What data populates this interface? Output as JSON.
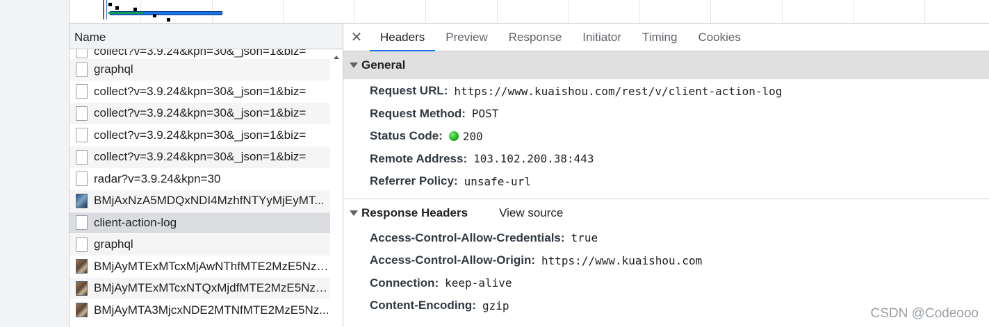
{
  "request_list": {
    "column_header": "Name",
    "rows": [
      {
        "name": "collect?v=3.9.24&kpn=30&_json=1&biz=",
        "icon": "document-icon",
        "partial": true
      },
      {
        "name": "graphql",
        "icon": "document-icon"
      },
      {
        "name": "collect?v=3.9.24&kpn=30&_json=1&biz=",
        "icon": "document-icon"
      },
      {
        "name": "collect?v=3.9.24&kpn=30&_json=1&biz=",
        "icon": "document-icon"
      },
      {
        "name": "collect?v=3.9.24&kpn=30&_json=1&biz=",
        "icon": "document-icon"
      },
      {
        "name": "collect?v=3.9.24&kpn=30&_json=1&biz=",
        "icon": "document-icon"
      },
      {
        "name": "radar?v=3.9.24&kpn=30",
        "icon": "document-icon"
      },
      {
        "name": "BMjAxNzA5MDQxNDI4MzhfNTYyMjEyMT...",
        "icon": "image-thumbnail-icon"
      },
      {
        "name": "client-action-log",
        "icon": "document-icon",
        "selected": true
      },
      {
        "name": "graphql",
        "icon": "document-icon"
      },
      {
        "name": "BMjAyMTExMTcxMjAwNThfMTE2MzE5NzE...",
        "icon": "image-thumbnail-icon"
      },
      {
        "name": "BMjAyMTExMTcxNTQxMjdfMTE2MzE5NzE...",
        "icon": "image-thumbnail-icon"
      },
      {
        "name": "BMjAyMTA3MjcxNDE2MTNfMTE2MzE5Nz...",
        "icon": "image-thumbnail-icon"
      }
    ]
  },
  "details": {
    "close_label": "✕",
    "tabs": [
      "Headers",
      "Preview",
      "Response",
      "Initiator",
      "Timing",
      "Cookies"
    ],
    "active_tab": "Headers",
    "general": {
      "title": "General",
      "fields": [
        {
          "key": "Request URL:",
          "value": "https://www.kuaishou.com/rest/v/client-action-log"
        },
        {
          "key": "Request Method:",
          "value": "POST"
        },
        {
          "key": "Status Code:",
          "value": "200",
          "status_color": "#1fb81f"
        },
        {
          "key": "Remote Address:",
          "value": "103.102.200.38:443"
        },
        {
          "key": "Referrer Policy:",
          "value": "unsafe-url"
        }
      ]
    },
    "response_headers": {
      "title": "Response Headers",
      "view_source": "View source",
      "fields": [
        {
          "key": "Access-Control-Allow-Credentials:",
          "value": "true"
        },
        {
          "key": "Access-Control-Allow-Origin:",
          "value": "https://www.kuaishou.com"
        },
        {
          "key": "Connection:",
          "value": "keep-alive"
        },
        {
          "key": "Content-Encoding:",
          "value": "gzip"
        }
      ]
    }
  },
  "watermark": "CSDN @Codeooo",
  "colors": {
    "accent": "#1a73e8",
    "selected_row": "#dadce0",
    "section_header": "#e0e0e0",
    "status_ok": "#1fb81f"
  }
}
